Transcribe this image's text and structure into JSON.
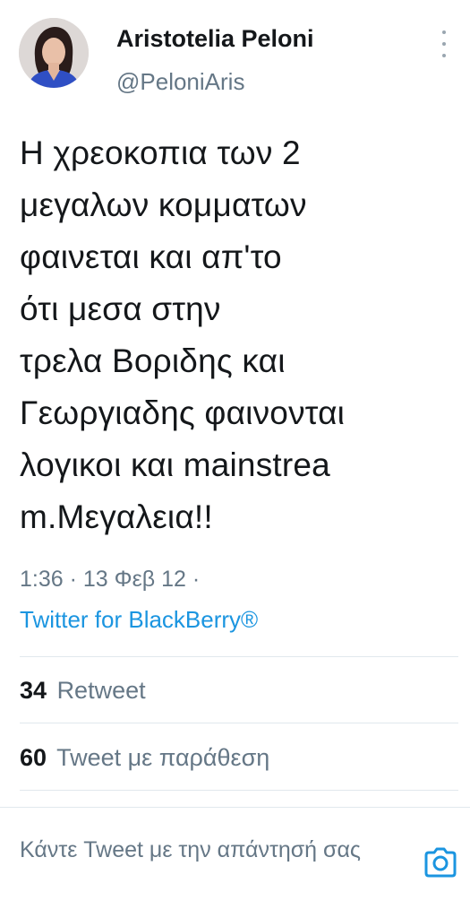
{
  "author": {
    "name": "Aristotelia Peloni",
    "handle": "@PeloniAris"
  },
  "tweet": {
    "text": "Η χρεοκοπια των 2\nμεγαλων κομματων\nφαινεται και απ'το\nότι μεσα στην\nτρελα Βοριδης και\nΓεωργιαδης φαινονται\nλογικοι και mainstrea\nm.Μεγαλεια!!",
    "time": "1:36",
    "date": "13 Φεβ 12",
    "source": "Twitter for BlackBerry®"
  },
  "stats": {
    "retweets": {
      "count": "34",
      "label": "Retweet"
    },
    "quotes": {
      "count": "60",
      "label": "Tweet με παράθεση"
    }
  },
  "reply": {
    "placeholder": "Κάντε Tweet με την απάντησή σας"
  },
  "icons": {
    "more": "more-vertical-icon",
    "camera": "camera-icon"
  },
  "colors": {
    "accent": "#1b95e0",
    "secondary_text": "#657786",
    "primary_text": "#14171a",
    "divider": "#e1e8ed"
  }
}
